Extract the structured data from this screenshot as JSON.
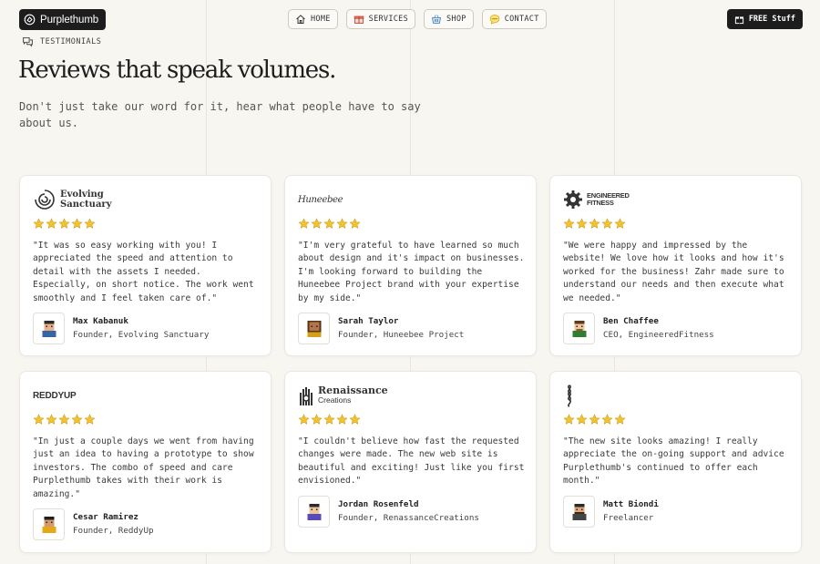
{
  "header": {
    "logo_text": "Purplethumb",
    "nav": [
      {
        "label": "HOME",
        "icon": "home-icon"
      },
      {
        "label": "SERVICES",
        "icon": "gift-icon"
      },
      {
        "label": "SHOP",
        "icon": "basket-icon"
      },
      {
        "label": "CONTACT",
        "icon": "chat-icon"
      }
    ],
    "cta_label": "FREE Stuff"
  },
  "section": {
    "eyebrow": "TESTIMONIALS",
    "title": "Reviews that speak volumes.",
    "subtitle": "Don't just take our word for it, hear what people have to say about us."
  },
  "colors": {
    "star": "#f2c230",
    "dark": "#1d1d1d",
    "background": "#f8f6f1"
  },
  "testimonials": [
    {
      "brand_line1": "Evolving",
      "brand_line2": "Sanctuary",
      "brand_icon": "swirl-logo-icon",
      "rating": 5,
      "quote": "\"It was so easy working with you! I appreciated the speed and attention to detail with the assets I needed. Especially, on short notice. The work went smoothly and I feel taken care of.\"",
      "name": "Max Kabanuk",
      "role": "Founder, Evolving Sanctuary"
    },
    {
      "brand_line1": "Huneebee",
      "brand_line2": "",
      "brand_icon": "",
      "rating": 5,
      "quote": "\"I'm very grateful to have learned so much about design and it's impact on businesses. I'm looking forward to building the Huneebee Project brand with your expertise by my side.\"",
      "name": "Sarah Taylor",
      "role": "Founder, Huneebee Project"
    },
    {
      "brand_line1": "ENGINEERED",
      "brand_line2": "FITNESS",
      "brand_icon": "gear-logo-icon",
      "rating": 5,
      "quote": "\"We were happy and impressed by the website! We love how it looks and how it's worked for the business! Zahr made sure to understand our needs and then execute what we needed.\"",
      "name": "Ben Chaffee",
      "role": "CEO, EngineeredFitness"
    },
    {
      "brand_line1": "REDDYUP",
      "brand_line2": "",
      "brand_icon": "",
      "rating": 5,
      "quote": "\"In just a couple days we went from having just an idea to having a prototype to show investors. The combo of speed and care Purplethumb takes with their work is amazing.\"",
      "name": "Cesar Ramirez",
      "role": "Founder, ReddyUp"
    },
    {
      "brand_line1": "Renaissance",
      "brand_line2": "Creations",
      "brand_icon": "hand-logo-icon",
      "rating": 5,
      "quote": "\"I couldn't believe how fast the requested changes were made. The new web site is beautiful and exciting! Just like you first envisioned.\"",
      "name": "Jordan Rosenfeld",
      "role": "Founder, RenassanceCreations"
    },
    {
      "brand_line1": "",
      "brand_line2": "",
      "brand_icon": "knot-logo-icon",
      "rating": 5,
      "quote": "\"The new site looks amazing! I really appreciate the on-going support and advice Purplethumb's continued to offer each month.\"",
      "name": "Matt Biondi",
      "role": "Freelancer"
    }
  ]
}
